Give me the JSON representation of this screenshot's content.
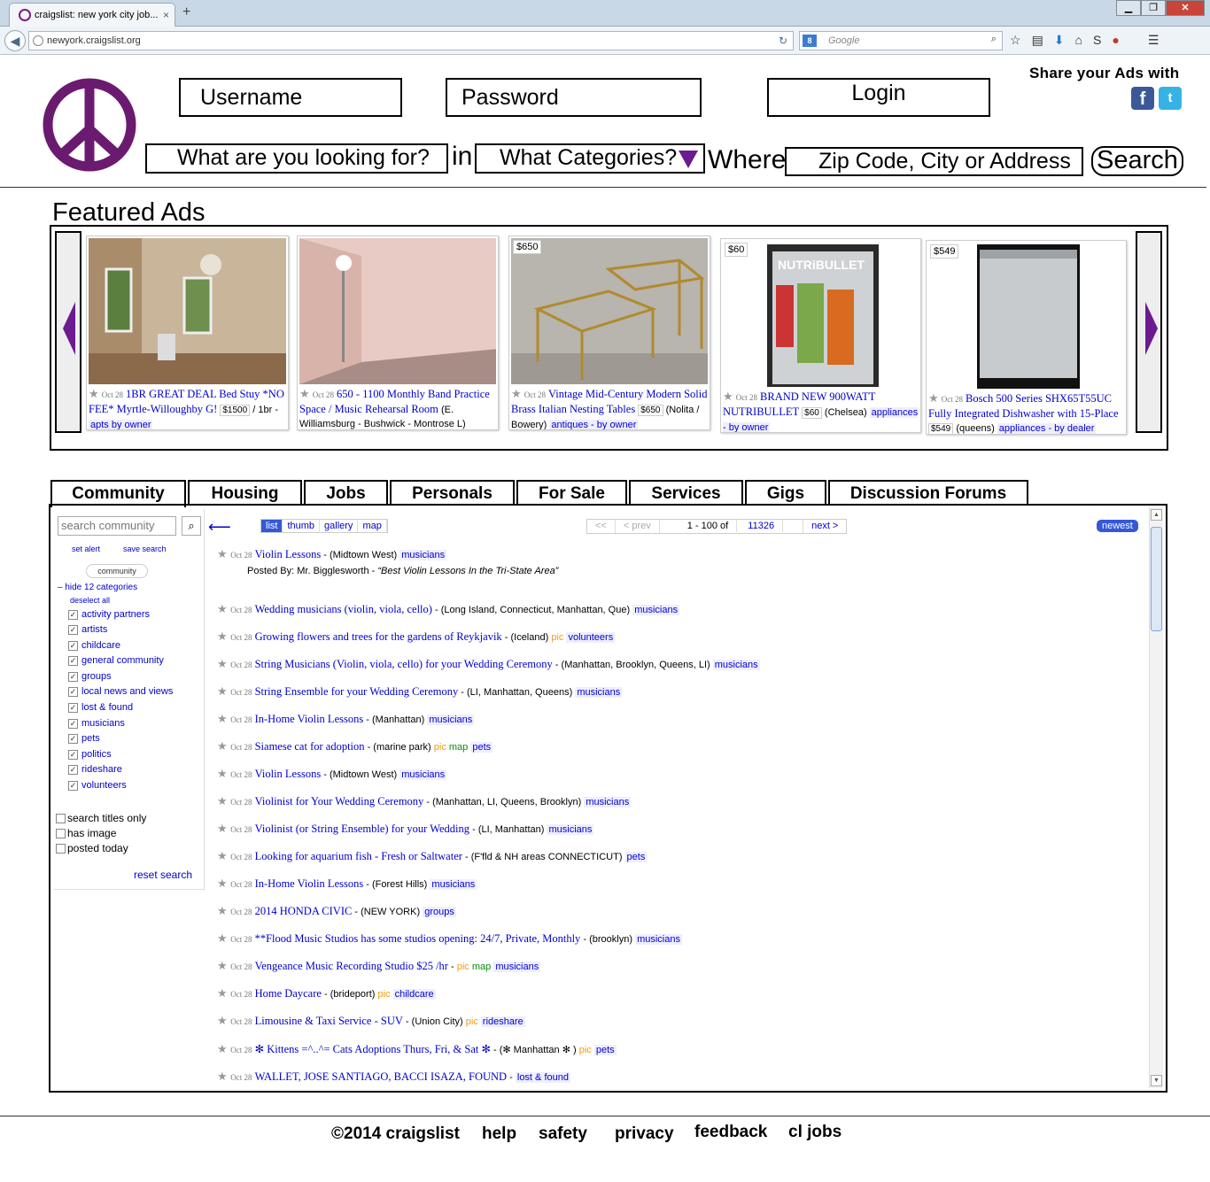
{
  "browser": {
    "tab_title": "craigslist: new york city job...",
    "tab_close": "×",
    "new_tab": "+",
    "url": "newyork.craigslist.org",
    "search_engine": "Google",
    "window_buttons": [
      "▁",
      "❐",
      "✕"
    ]
  },
  "header": {
    "username_placeholder": "Username",
    "password_placeholder": "Password",
    "login_label": "Login",
    "share_label": "Share your Ads with",
    "facebook": "f",
    "twitter": "t",
    "search_placeholder": "What are you looking for?",
    "in_label": "in",
    "category_placeholder": "What Categories?",
    "where_label": "Where",
    "location_placeholder": "Zip Code, City or Address",
    "search_button": "Search",
    "logo_color": "#6b1b6f"
  },
  "featured": {
    "title": "Featured Ads",
    "ads": [
      {
        "price": "",
        "date": "Oct 28",
        "title": "1BR GREAT DEAL Bed Stuy *NO FEE* Myrtle-Willoughby G!",
        "price_tag": "$1500",
        "location": "/ 1br -",
        "category": "apts by owner"
      },
      {
        "price": "",
        "date": "Oct 28",
        "title": "650 - 1100 Monthly Band Practice Space / Music Rehearsal Room",
        "price_tag": "",
        "location": "(E. Williamsburg - Bushwick - Montrose L)",
        "category": ""
      },
      {
        "price": "$650",
        "date": "Oct 28",
        "title": "Vintage Mid-Century Modern Solid Brass Italian Nesting Tables",
        "price_tag": "$650",
        "location": "(Nolita / Bowery)",
        "category": "antiques - by owner"
      },
      {
        "price": "$60",
        "date": "Oct 28",
        "title": "BRAND NEW 900WATT NUTRIBULLET",
        "price_tag": "$60",
        "location": "(Chelsea)",
        "category": "appliances - by owner"
      },
      {
        "price": "$549",
        "date": "Oct 28",
        "title": "Bosch 500 Series SHX65T55UC Fully Integrated Dishwasher with 15-Place",
        "price_tag": "$549",
        "location": "(queens)",
        "category": "appliances - by dealer"
      }
    ]
  },
  "tabs": [
    "Community",
    "Housing",
    "Jobs",
    "Personals",
    "For Sale",
    "Services",
    "Gigs",
    "Discussion Forums"
  ],
  "sidebar": {
    "search_placeholder": "search community",
    "set_alert": "set alert",
    "save_search": "save search",
    "section": "community",
    "hide_categories": "– hide 12 categories",
    "deselect_all": "deselect all",
    "categories": [
      "activity partners",
      "artists",
      "childcare",
      "general community",
      "groups",
      "local news and views",
      "lost & found",
      "musicians",
      "pets",
      "politics",
      "rideshare",
      "volunteers"
    ],
    "options": [
      "search titles only",
      "has image",
      "posted today"
    ],
    "reset": "reset search"
  },
  "listing": {
    "view_modes": [
      "list",
      "thumb",
      "gallery",
      "map"
    ],
    "pager_first": "<<",
    "pager_prev": "< prev",
    "pager_range": "1 - 100 of",
    "pager_total": "11326",
    "pager_next": "next >",
    "sort": "newest",
    "posted_by": "Posted By: Mr. Bigglesworth - ",
    "posted_quote": "“Best Violin Lessons In the Tri-State Area”",
    "posts": [
      {
        "date": "Oct 28",
        "title": "Violin Lessons",
        "loc": "(Midtown West)",
        "pic": "",
        "map": "",
        "cat": "musicians"
      },
      {
        "date": "Oct 28",
        "title": "Wedding musicians (violin, viola, cello)",
        "loc": "(Long Island, Connecticut, Manhattan, Que)",
        "pic": "",
        "map": "",
        "cat": "musicians"
      },
      {
        "date": "Oct 28",
        "title": "Growing flowers and trees for the gardens of Reykjavik",
        "loc": "(Iceland)",
        "pic": "pic",
        "map": "",
        "cat": "volunteers"
      },
      {
        "date": "Oct 28",
        "title": "String Musicians (Violin, viola, cello) for your Wedding Ceremony",
        "loc": "(Manhattan, Brooklyn, Queens, LI)",
        "pic": "",
        "map": "",
        "cat": "musicians"
      },
      {
        "date": "Oct 28",
        "title": "String Ensemble for your Wedding Ceremony",
        "loc": "(LI, Manhattan, Queens)",
        "pic": "",
        "map": "",
        "cat": "musicians"
      },
      {
        "date": "Oct 28",
        "title": "In-Home Violin Lessons",
        "loc": "(Manhattan)",
        "pic": "",
        "map": "",
        "cat": "musicians"
      },
      {
        "date": "Oct 28",
        "title": "Siamese cat for adoption",
        "loc": "(marine park)",
        "pic": "pic",
        "map": "map",
        "cat": "pets"
      },
      {
        "date": "Oct 28",
        "title": "Violin Lessons",
        "loc": "(Midtown West)",
        "pic": "",
        "map": "",
        "cat": "musicians"
      },
      {
        "date": "Oct 28",
        "title": "Violinist for Your Wedding Ceremony",
        "loc": "(Manhattan, LI, Queens, Brooklyn)",
        "pic": "",
        "map": "",
        "cat": "musicians"
      },
      {
        "date": "Oct 28",
        "title": "Violinist (or String Ensemble) for your Wedding",
        "loc": "(LI, Manhattan)",
        "pic": "",
        "map": "",
        "cat": "musicians"
      },
      {
        "date": "Oct 28",
        "title": "Looking for aquarium fish - Fresh or Saltwater",
        "loc": "(F'fld & NH areas CONNECTICUT)",
        "pic": "",
        "map": "",
        "cat": "pets"
      },
      {
        "date": "Oct 28",
        "title": "In-Home Violin Lessons",
        "loc": "(Forest Hills)",
        "pic": "",
        "map": "",
        "cat": "musicians"
      },
      {
        "date": "Oct 28",
        "title": "2014 HONDA CIVIC",
        "loc": "(NEW YORK)",
        "pic": "",
        "map": "",
        "cat": "groups"
      },
      {
        "date": "Oct 28",
        "title": "**Flood Music Studios has some studios opening: 24/7, Private, Monthly",
        "loc": "(brooklyn)",
        "pic": "",
        "map": "",
        "cat": "musicians"
      },
      {
        "date": "Oct 28",
        "title": "Vengeance Music Recording Studio $25 /hr",
        "loc": "",
        "pic": "pic",
        "map": "map",
        "cat": "musicians"
      },
      {
        "date": "Oct 28",
        "title": "Home Daycare",
        "loc": "(brideport)",
        "pic": "pic",
        "map": "",
        "cat": "childcare"
      },
      {
        "date": "Oct 28",
        "title": "Limousine & Taxi Service - SUV",
        "loc": "(Union City)",
        "pic": "pic",
        "map": "",
        "cat": "rideshare"
      },
      {
        "date": "Oct 28",
        "title": "✻ Kittens =^..^= Cats Adoptions Thurs, Fri, & Sat ✻",
        "loc": "(✻ Manhattan ✻ )",
        "pic": "pic",
        "map": "",
        "cat": "pets"
      },
      {
        "date": "Oct 28",
        "title": "WALLET, JOSE SANTIAGO, BACCI ISAZA, FOUND",
        "loc": "",
        "pic": "",
        "map": "",
        "cat": "lost & found"
      }
    ]
  },
  "footer": [
    "©2014 craigslist",
    "help",
    "safety",
    "privacy",
    "feedback",
    "cl jobs"
  ]
}
